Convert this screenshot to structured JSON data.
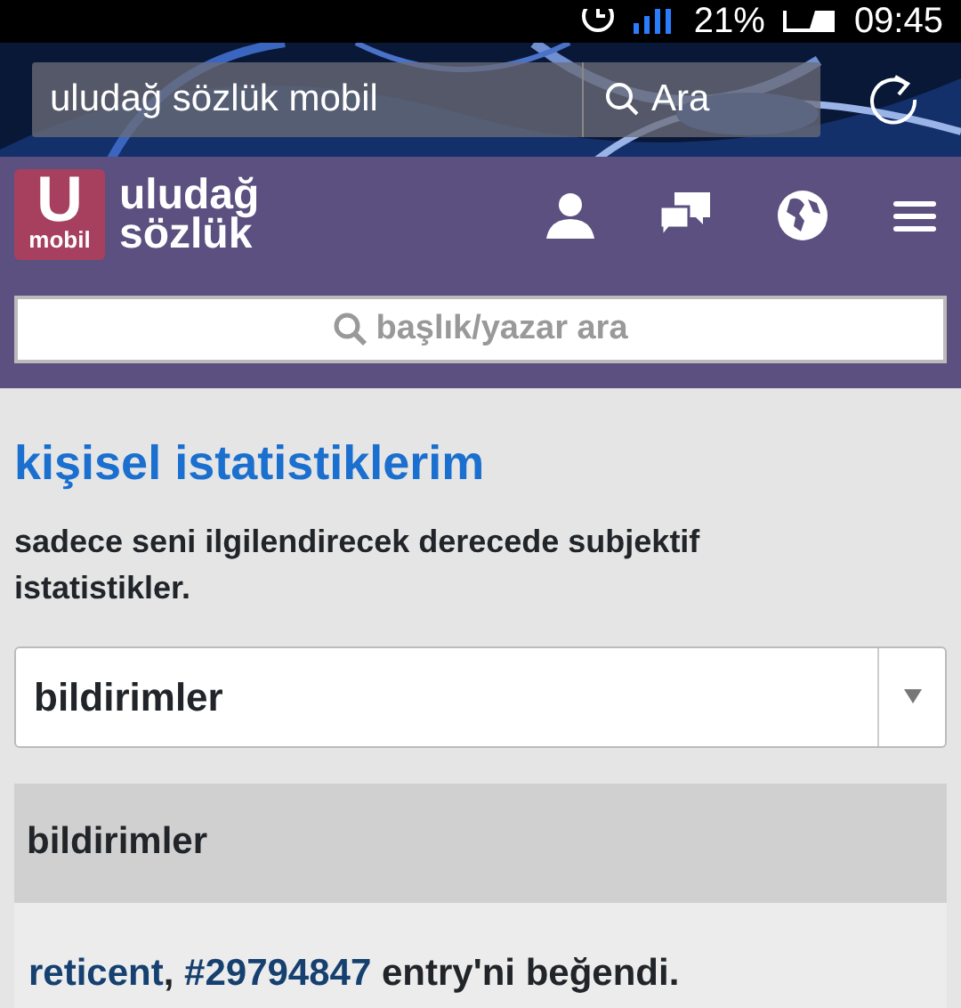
{
  "status_bar": {
    "battery_percent": "21%",
    "time": "09:45"
  },
  "browser": {
    "url": "uludağ sözlük mobil",
    "search_button": "Ara"
  },
  "site": {
    "logo_letter": "U",
    "logo_sub": "mobil",
    "logo_line1": "uludağ",
    "logo_line2": "sözlük",
    "search_placeholder": "başlık/yazar ara"
  },
  "page": {
    "title": "kişisel istatistiklerim",
    "subtitle": "sadece seni ilgilendirecek derecede subjektif istatistikler.",
    "select_value": "bildirimler",
    "panel_title": "bildirimler",
    "notifications": [
      {
        "user": "reticent",
        "separator": ", ",
        "entry": "#29794847",
        "text": " entry'ni beğendi."
      }
    ]
  }
}
